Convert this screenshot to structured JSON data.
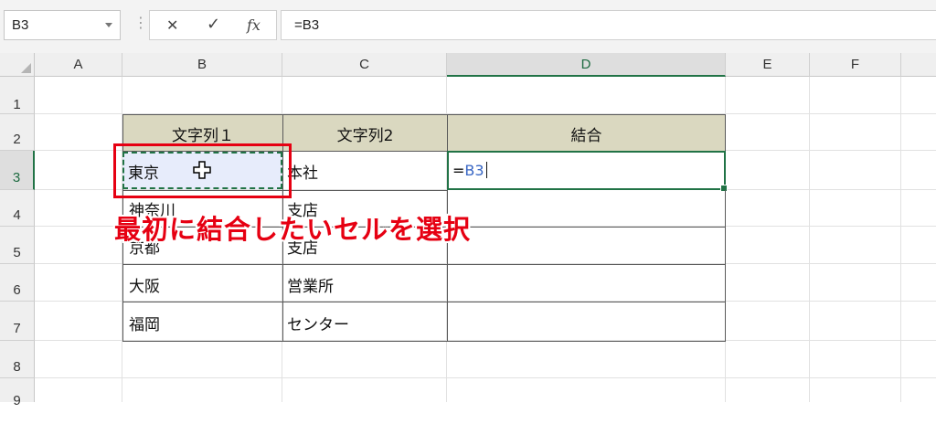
{
  "formula_bar": {
    "name_box": "B3",
    "cancel_icon": "✕",
    "enter_icon": "✓",
    "function_icon": "fx",
    "formula": "=B3"
  },
  "columns": [
    "A",
    "B",
    "C",
    "D",
    "E",
    "F"
  ],
  "rows": [
    "1",
    "2",
    "3",
    "4",
    "5",
    "6",
    "7",
    "8",
    "9"
  ],
  "selected": {
    "column": "D",
    "row": "3"
  },
  "table": {
    "headers": [
      "文字列１",
      "文字列2",
      "結合"
    ],
    "rows": [
      {
        "b": "東京",
        "c": "本社",
        "d": ""
      },
      {
        "b": "神奈川",
        "c": "支店",
        "d": ""
      },
      {
        "b": "京都",
        "c": "支店",
        "d": ""
      },
      {
        "b": "大阪",
        "c": "営業所",
        "d": ""
      },
      {
        "b": "福岡",
        "c": "センター",
        "d": ""
      }
    ]
  },
  "active_cell": {
    "prefix": "=",
    "ref": "B3"
  },
  "annotation": {
    "text": "最初に結合したいセルを選択",
    "color": "#e60012"
  },
  "colors": {
    "header_fill": "#dad8c0",
    "selection": "#217346",
    "copy_fill": "#e7ecfb",
    "accent_red": "#e60012"
  }
}
